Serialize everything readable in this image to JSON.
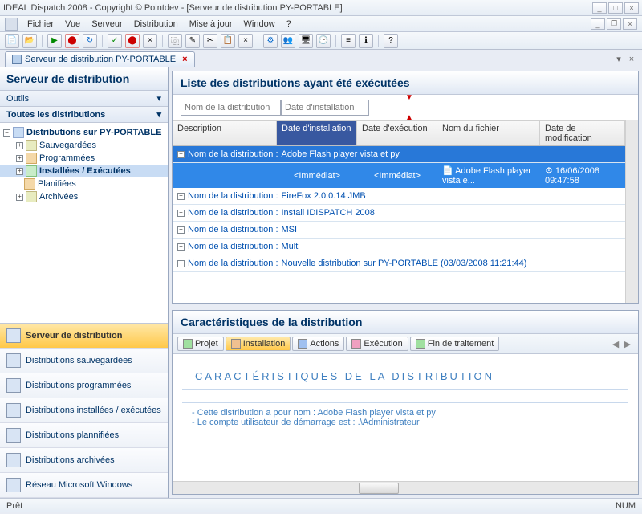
{
  "window": {
    "title": "IDEAL Dispatch 2008 - Copyright © Pointdev - [Serveur de distribution PY-PORTABLE]"
  },
  "menu": {
    "fichier": "Fichier",
    "vue": "Vue",
    "serveur": "Serveur",
    "distribution": "Distribution",
    "maj": "Mise à jour",
    "window": "Window",
    "help": "?"
  },
  "tab": {
    "label": "Serveur de distribution PY-PORTABLE"
  },
  "sidebar": {
    "header": "Serveur de distribution",
    "tools": "Outils",
    "alldist": "Toutes les distributions",
    "root": "Distributions sur PY-PORTABLE",
    "items": [
      "Sauvegardées",
      "Programmées",
      "Installées / Exécutées",
      "Planifiées",
      "Archivées"
    ]
  },
  "nav": {
    "items": [
      "Serveur de distribution",
      "Distributions sauvegardées",
      "Distributions programmées",
      "Distributions installées / exécutées",
      "Distributions plannifiées",
      "Distributions archivées",
      "Réseau Microsoft Windows"
    ]
  },
  "listpanel": {
    "title": "Liste des distributions ayant été exécutées",
    "filter_name_ph": "Nom de la distribution",
    "filter_date_ph": "Date d'installation",
    "cols": {
      "desc": "Description",
      "inst": "Date d'installation",
      "exec": "Date d'exécution",
      "file": "Nom du fichier",
      "mod": "Date de modification"
    },
    "group_prefix": "Nom de la distribution : ",
    "groups": [
      "Adobe Flash player vista et py",
      "FireFox 2.0.0.14 JMB",
      "Install IDISPATCH 2008",
      "MSI",
      "Multi",
      "Nouvelle distribution sur PY-PORTABLE (03/03/2008 11:21:44)"
    ],
    "row": {
      "inst": "<Immédiat>",
      "exec": "<Immédiat>",
      "file": "Adobe Flash player vista e...",
      "mod": "16/06/2008 09:47:58"
    }
  },
  "charpanel": {
    "title": "Caractéristiques de la distribution",
    "tabs": [
      "Projet",
      "Installation",
      "Actions",
      "Exécution",
      "Fin de traitement"
    ],
    "body_title": "Caractéristiques de la distribution",
    "line1": "- Cette distribution a pour nom : Adobe Flash player vista et py",
    "line2": "- Le compte utilisateur de démarrage est : .\\Administrateur"
  },
  "status": {
    "ready": "Prêt",
    "num": "NUM"
  }
}
